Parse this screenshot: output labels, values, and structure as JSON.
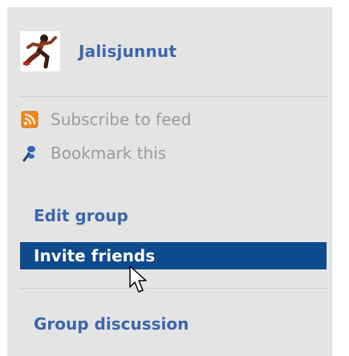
{
  "group": {
    "name": "Jalisjunnut",
    "avatar_icon": "runner-avatar-icon"
  },
  "feed_links": [
    {
      "label": "Subscribe to feed",
      "icon": "rss-feed-icon"
    },
    {
      "label": "Bookmark this",
      "icon": "bookmark-pin-icon"
    }
  ],
  "menu": {
    "edit": "Edit group",
    "invite": "Invite friends",
    "discussion": "Group discussion"
  },
  "colors": {
    "panel_bg": "#e4e4e4",
    "link": "#3b67a8",
    "active_bg": "#0e4a8e",
    "muted_text": "#9b9b9b"
  }
}
